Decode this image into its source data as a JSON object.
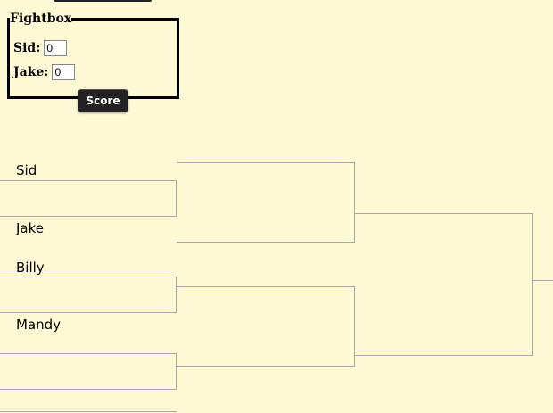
{
  "fightbox": {
    "legend": "Fightbox",
    "sid_label": "Sid:",
    "sid_value": "0",
    "jake_label": "Jake:",
    "jake_value": "0",
    "score_button": "Score"
  },
  "bracket": {
    "round1": [
      "Sid",
      "Jake",
      "Billy",
      "Mandy"
    ]
  }
}
